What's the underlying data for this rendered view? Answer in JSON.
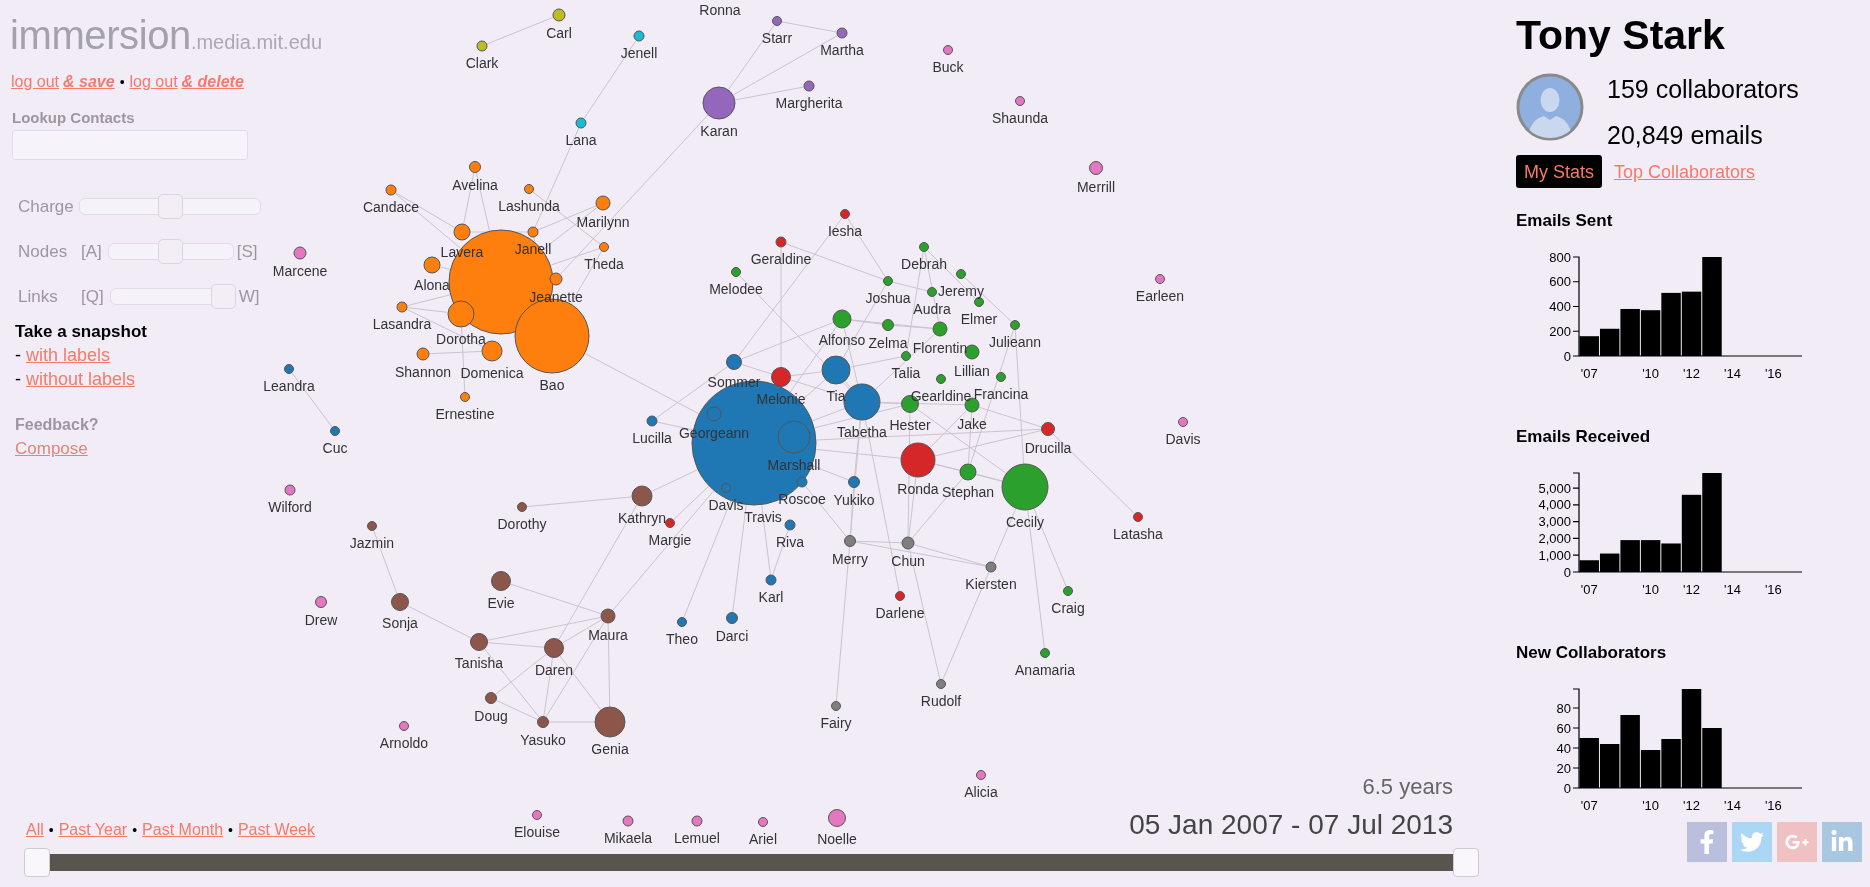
{
  "site": {
    "name": "immersion",
    "domain": ".media.mit.edu"
  },
  "account_links": [
    {
      "text": "log out",
      "emphasis": "& save"
    },
    {
      "separator": "•",
      "text": "log out",
      "emphasis": "& delete"
    }
  ],
  "lookup": {
    "label": "Lookup Contacts"
  },
  "settings": {
    "sliders": [
      {
        "label": "Charge",
        "level": 0.5
      },
      {
        "label": "Nodes",
        "left_key": "[A]",
        "right_key": "[S]",
        "level": 0.5
      },
      {
        "label": "Links",
        "left_key": "[Q]",
        "right_key": "W]",
        "level": 1
      }
    ]
  },
  "snapshot": {
    "title": "Take a snapshot",
    "options": [
      {
        "prefix": "-",
        "link": "with labels"
      },
      {
        "prefix": "-",
        "link": "without labels"
      }
    ]
  },
  "feedback": {
    "title": "Feedback?",
    "link": "Compose"
  },
  "graph": {
    "nodes": [
      {
        "label": "Ronna"
      },
      {
        "label": "Carl",
        "color": "#bcbd22"
      },
      {
        "label": "Starr",
        "color": "#9467bd"
      },
      {
        "label": "Jenell",
        "color": "#17becf"
      },
      {
        "label": "Martha",
        "color": "#9467bd"
      },
      {
        "label": "Clark",
        "color": "#bcbd22"
      },
      {
        "label": "Buck",
        "color": "#e377c2"
      },
      {
        "label": "Margherita",
        "color": "#9467bd"
      },
      {
        "label": "Shaunda",
        "color": "#e377c2"
      },
      {
        "label": "Lana",
        "color": "#17becf"
      },
      {
        "label": "Karan",
        "color": "#9467bd"
      },
      {
        "label": "Avelina",
        "color": "#ff7f0e"
      },
      {
        "label": "Merrill",
        "color": "#e377c2"
      },
      {
        "label": "Candace",
        "color": "#ff7f0e"
      },
      {
        "label": "Lashunda",
        "color": "#ff7f0e"
      },
      {
        "label": "Marilynn",
        "color": "#ff7f0e"
      },
      {
        "label": "Iesha",
        "color": "#d62728"
      },
      {
        "label": "Lavera",
        "color": "#ff7f0e"
      },
      {
        "label": "Janell",
        "color": "#ff7f0e"
      },
      {
        "label": "Marcene",
        "color": "#e377c2"
      },
      {
        "label": "Theda",
        "color": "#ff7f0e"
      },
      {
        "label": "Geraldine",
        "color": "#d62728"
      },
      {
        "label": "Debrah",
        "color": "#2ca02c"
      },
      {
        "label": "Alona",
        "color": "#ff7f0e"
      },
      {
        "color": "#ff7f0e"
      },
      {
        "label": "Jeanette",
        "color": "#ff7f0e"
      },
      {
        "label": "Melodee",
        "color": "#2ca02c"
      },
      {
        "label": "Joshua",
        "color": "#2ca02c"
      },
      {
        "label": "Jeremy",
        "color": "#2ca02c"
      },
      {
        "label": "Audra",
        "color": "#2ca02c"
      },
      {
        "label": "Earleen",
        "color": "#e377c2"
      },
      {
        "label": "Lasandra",
        "color": "#ff7f0e"
      },
      {
        "label": "Elmer",
        "color": "#2ca02c"
      },
      {
        "label": "Dorotha",
        "color": "#ff7f0e"
      },
      {
        "label": "Alfonso",
        "color": "#2ca02c"
      },
      {
        "label": "Zelma",
        "color": "#2ca02c"
      },
      {
        "label": "Florentin",
        "color": "#2ca02c"
      },
      {
        "label": "Julieann",
        "color": "#2ca02c"
      },
      {
        "label": "Leandra",
        "color": "#1f77b4"
      },
      {
        "label": "Shannon",
        "color": "#ff7f0e"
      },
      {
        "label": "Domenica",
        "color": "#ff7f0e"
      },
      {
        "label": "Bao",
        "color": "#ff7f0e"
      },
      {
        "label": "Sommer",
        "color": "#1f77b4"
      },
      {
        "label": "Melonie",
        "color": "#d62728"
      },
      {
        "label": "Tia",
        "color": "#1f77b4"
      },
      {
        "label": "Talia",
        "color": "#2ca02c"
      },
      {
        "label": "Lillian",
        "color": "#2ca02c"
      },
      {
        "label": "Gearldine",
        "color": "#2ca02c"
      },
      {
        "label": "Francina",
        "color": "#2ca02c"
      },
      {
        "label": "Ernestine",
        "color": "#ff7f0e"
      },
      {
        "label": "Cuc",
        "color": "#1f77b4"
      },
      {
        "label": "Lucilla",
        "color": "#1f77b4"
      },
      {
        "label": "Georgeann",
        "color": "#1f77b4"
      },
      {
        "color": "#1f77b4"
      },
      {
        "label": "Tabetha",
        "color": "#1f77b4"
      },
      {
        "label": "Hester",
        "color": "#2ca02c"
      },
      {
        "label": "Jake",
        "color": "#2ca02c"
      },
      {
        "label": "Drucilla",
        "color": "#d62728"
      },
      {
        "label": "Davis",
        "color": "#e377c2"
      },
      {
        "label": "Marshall",
        "color": "#1f77b4"
      },
      {
        "label": "Wilford",
        "color": "#e377c2"
      },
      {
        "label": "Davis",
        "color": "#1f77b4"
      },
      {
        "label": "Roscoe",
        "color": "#1f77b4"
      },
      {
        "label": "Yukiko",
        "color": "#1f77b4"
      },
      {
        "label": "Ronda",
        "color": "#d62728"
      },
      {
        "label": "Stephan",
        "color": "#2ca02c"
      },
      {
        "label": "Dorothy",
        "color": "#8c564b"
      },
      {
        "label": "Kathryn",
        "color": "#8c564b"
      },
      {
        "label": "Travis"
      },
      {
        "label": "Cecily",
        "color": "#2ca02c"
      },
      {
        "label": "Jazmin",
        "color": "#8c564b"
      },
      {
        "label": "Margie",
        "color": "#d62728"
      },
      {
        "label": "Riva",
        "color": "#1f77b4"
      },
      {
        "label": "Latasha",
        "color": "#d62728"
      },
      {
        "label": "Merry",
        "color": "#7f7f7f"
      },
      {
        "label": "Chun",
        "color": "#7f7f7f"
      },
      {
        "label": "Kiersten",
        "color": "#7f7f7f"
      },
      {
        "label": "Drew",
        "color": "#e377c2"
      },
      {
        "label": "Sonja",
        "color": "#8c564b"
      },
      {
        "label": "Evie",
        "color": "#8c564b"
      },
      {
        "label": "Karl",
        "color": "#1f77b4"
      },
      {
        "label": "Darlene",
        "color": "#d62728"
      },
      {
        "label": "Craig",
        "color": "#2ca02c"
      },
      {
        "label": "Maura",
        "color": "#8c564b"
      },
      {
        "label": "Theo",
        "color": "#1f77b4"
      },
      {
        "label": "Darci",
        "color": "#1f77b4"
      },
      {
        "label": "Tanisha",
        "color": "#8c564b"
      },
      {
        "label": "Daren",
        "color": "#8c564b"
      },
      {
        "label": "Anamaria",
        "color": "#2ca02c"
      },
      {
        "label": "Rudolf",
        "color": "#7f7f7f"
      },
      {
        "label": "Doug",
        "color": "#8c564b"
      },
      {
        "label": "Fairy",
        "color": "#7f7f7f"
      },
      {
        "label": "Arnoldo",
        "color": "#e377c2"
      },
      {
        "label": "Yasuko",
        "color": "#8c564b"
      },
      {
        "label": "Genia",
        "color": "#8c564b"
      },
      {
        "label": "Alicia",
        "color": "#e377c2"
      },
      {
        "label": "Elouise",
        "color": "#e377c2"
      },
      {
        "label": "Mikaela",
        "color": "#e377c2"
      },
      {
        "label": "Lemuel",
        "color": "#e377c2"
      },
      {
        "label": "Ariel",
        "color": "#e377c2"
      },
      {
        "label": "Noelle",
        "color": "#e377c2"
      }
    ]
  },
  "time_filters": [
    {
      "label": "All"
    },
    {
      "separator": "•",
      "label": "Past Year"
    },
    {
      "separator": "•",
      "label": "Past Month"
    },
    {
      "separator": "•",
      "label": "Past Week"
    }
  ],
  "timeline": {
    "duration": "6.5 years",
    "range": "05 Jan 2007 - 07 Jul 2013",
    "handles": [
      {
        "level": 0
      },
      {
        "level": 1
      }
    ]
  },
  "profile": {
    "name": "Tony Stark",
    "collaborators": "159 collaborators",
    "emails": "20,849 emails",
    "tabs": [
      {
        "label": "My Stats",
        "selected": true
      },
      {
        "label": "Top Collaborators",
        "selected": false
      }
    ]
  },
  "charts": [
    {
      "chart_data": {
        "type": "bar",
        "title": "Emails Sent",
        "x": [
          2007,
          2008,
          2009,
          2010,
          2011,
          2012,
          2013
        ],
        "values": [
          160,
          220,
          380,
          370,
          510,
          520,
          800
        ],
        "xlim": [
          2006.5,
          2017.4
        ],
        "ylim": [
          0,
          800
        ],
        "xticks": [
          {
            "value": 2007,
            "label": "'07"
          },
          {
            "value": 2010,
            "label": "'10"
          },
          {
            "value": 2012,
            "label": "'12"
          },
          {
            "value": 2014,
            "label": "'14"
          },
          {
            "value": 2016,
            "label": "'16"
          }
        ],
        "yticks": [
          0,
          200,
          400,
          600,
          800
        ]
      }
    },
    {
      "chart_data": {
        "type": "bar",
        "title": "Emails Received",
        "x": [
          2007,
          2008,
          2009,
          2010,
          2011,
          2012,
          2013
        ],
        "values": [
          700,
          1100,
          1900,
          1900,
          1700,
          4600,
          5900
        ],
        "xlim": [
          2006.5,
          2017.4
        ],
        "ylim": [
          0,
          5900
        ],
        "xticks": [
          {
            "value": 2007,
            "label": "'07"
          },
          {
            "value": 2010,
            "label": "'10"
          },
          {
            "value": 2012,
            "label": "'12"
          },
          {
            "value": 2014,
            "label": "'14"
          },
          {
            "value": 2016,
            "label": "'16"
          }
        ],
        "yticks": [
          0,
          {
            "value": 1000,
            "label": "1,000"
          },
          {
            "value": 2000,
            "label": "2,000"
          },
          {
            "value": 3000,
            "label": "3,000"
          },
          {
            "value": 4000,
            "label": "4,000"
          },
          {
            "value": 5000,
            "label": "5,000"
          }
        ]
      }
    },
    {
      "chart_data": {
        "type": "bar",
        "title": "New Collaborators",
        "x": [
          2007,
          2008,
          2009,
          2010,
          2011,
          2012,
          2013
        ],
        "values": [
          50,
          44,
          73,
          38,
          49,
          99,
          60
        ],
        "xlim": [
          2006.5,
          2017.4
        ],
        "ylim": [
          0,
          99
        ],
        "xticks": [
          {
            "value": 2007,
            "label": "'07"
          },
          {
            "value": 2010,
            "label": "'10"
          },
          {
            "value": 2012,
            "label": "'12"
          },
          {
            "value": 2014,
            "label": "'14"
          },
          {
            "value": 2016,
            "label": "'16"
          }
        ],
        "yticks": [
          0,
          20,
          40,
          60,
          80
        ]
      }
    }
  ]
}
